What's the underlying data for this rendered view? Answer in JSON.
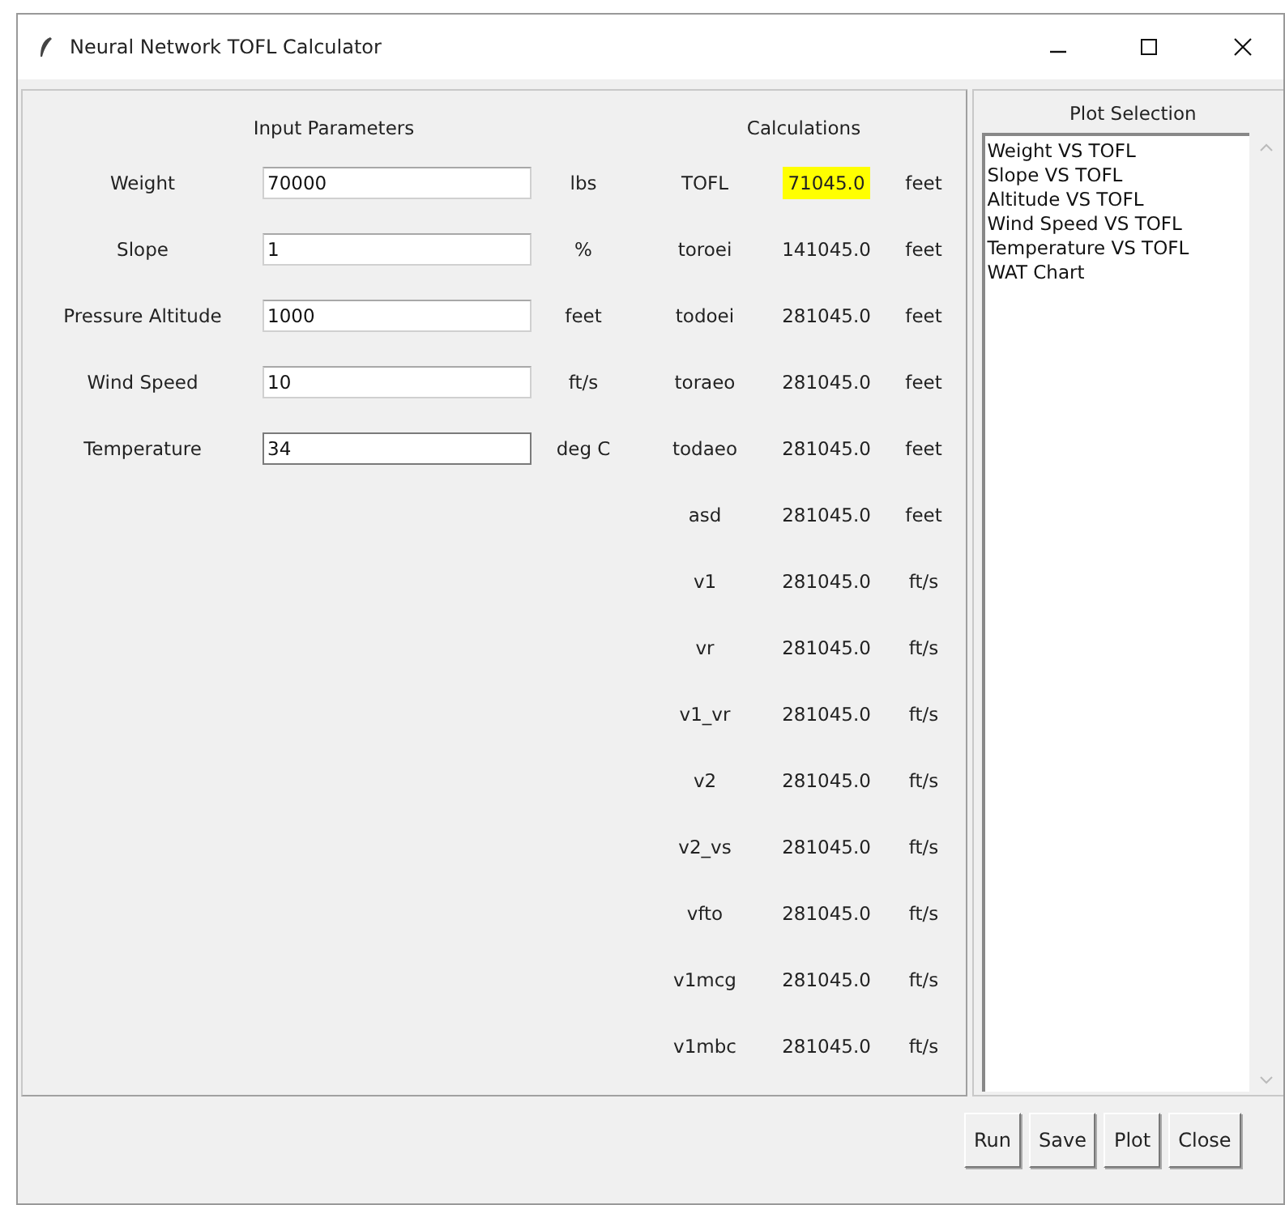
{
  "window": {
    "title": "Neural Network TOFL Calculator"
  },
  "inputs": {
    "heading": "Input Parameters",
    "fields": [
      {
        "label": "Weight",
        "value": "70000",
        "unit": "lbs",
        "focused": false
      },
      {
        "label": "Slope",
        "value": "1",
        "unit": "%",
        "focused": false
      },
      {
        "label": "Pressure Altitude",
        "value": "1000",
        "unit": "feet",
        "focused": false
      },
      {
        "label": "Wind Speed",
        "value": "10",
        "unit": "ft/s",
        "focused": false
      },
      {
        "label": "Temperature",
        "value": "34",
        "unit": "deg C",
        "focused": true
      }
    ]
  },
  "calculations": {
    "heading": "Calculations",
    "rows": [
      {
        "name": "TOFL",
        "value": "71045.0",
        "unit": "feet",
        "highlighted": true
      },
      {
        "name": "toroei",
        "value": "141045.0",
        "unit": "feet",
        "highlighted": false
      },
      {
        "name": "todoei",
        "value": "281045.0",
        "unit": "feet",
        "highlighted": false
      },
      {
        "name": "toraeo",
        "value": "281045.0",
        "unit": "feet",
        "highlighted": false
      },
      {
        "name": "todaeo",
        "value": "281045.0",
        "unit": "feet",
        "highlighted": false
      },
      {
        "name": "asd",
        "value": "281045.0",
        "unit": "feet",
        "highlighted": false
      },
      {
        "name": "v1",
        "value": "281045.0",
        "unit": "ft/s",
        "highlighted": false
      },
      {
        "name": "vr",
        "value": "281045.0",
        "unit": "ft/s",
        "highlighted": false
      },
      {
        "name": "v1_vr",
        "value": "281045.0",
        "unit": "ft/s",
        "highlighted": false
      },
      {
        "name": "v2",
        "value": "281045.0",
        "unit": "ft/s",
        "highlighted": false
      },
      {
        "name": "v2_vs",
        "value": "281045.0",
        "unit": "ft/s",
        "highlighted": false
      },
      {
        "name": "vfto",
        "value": "281045.0",
        "unit": "ft/s",
        "highlighted": false
      },
      {
        "name": "v1mcg",
        "value": "281045.0",
        "unit": "ft/s",
        "highlighted": false
      },
      {
        "name": "v1mbc",
        "value": "281045.0",
        "unit": "ft/s",
        "highlighted": false
      }
    ]
  },
  "plot_selection": {
    "heading": "Plot Selection",
    "items": [
      {
        "label": "Weight VS TOFL",
        "selected": false
      },
      {
        "label": "Slope VS TOFL",
        "selected": false
      },
      {
        "label": "Altitude VS TOFL",
        "selected": false
      },
      {
        "label": "Wind Speed VS TOFL",
        "selected": false
      },
      {
        "label": "Temperature VS TOFL",
        "selected": false
      },
      {
        "label": "WAT Chart",
        "selected": false
      }
    ]
  },
  "buttons": [
    "Run",
    "Save",
    "Plot",
    "Close"
  ]
}
